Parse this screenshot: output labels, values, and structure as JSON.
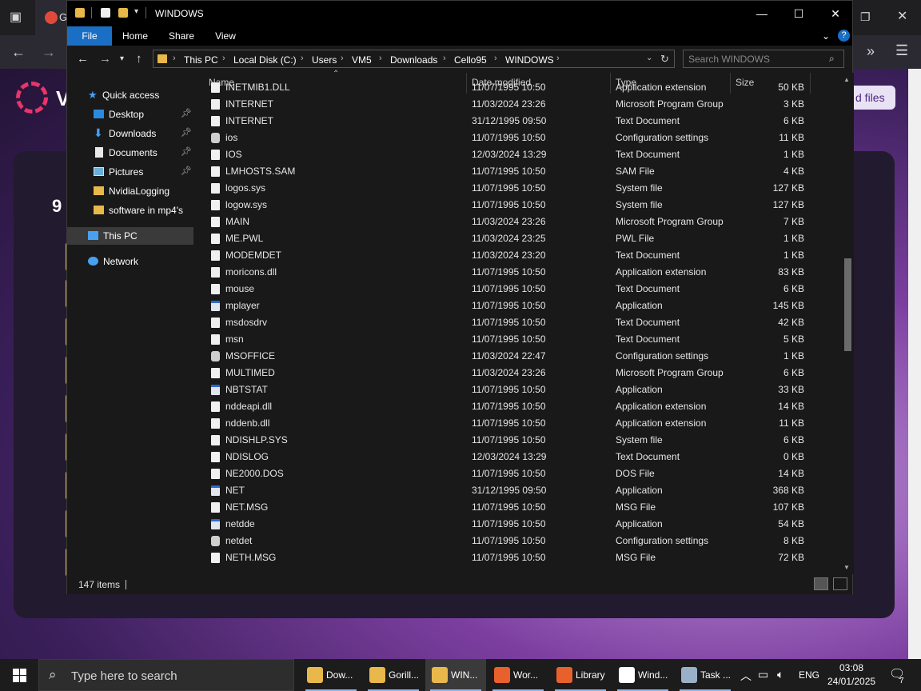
{
  "browser": {
    "tab_letter": "G",
    "site_letter": "V",
    "button_label": "d files",
    "heading_digit": "9"
  },
  "explorer": {
    "title": "WINDOWS",
    "window_controls": {
      "minimize": "—",
      "maximize": "☐",
      "close": "✕"
    },
    "ribbon_tabs": [
      "File",
      "Home",
      "Share",
      "View"
    ],
    "breadcrumbs": [
      "This PC",
      "Local Disk (C:)",
      "Users",
      "VM5",
      "Downloads",
      "Cello95",
      "WINDOWS"
    ],
    "search_placeholder": "Search WINDOWS",
    "nav_pane": {
      "quick_access": "Quick access",
      "items": [
        "Desktop",
        "Downloads",
        "Documents",
        "Pictures",
        "NvidiaLogging",
        "software in mp4's"
      ],
      "this_pc": "This PC",
      "network": "Network"
    },
    "columns": {
      "name": "Name",
      "date": "Date modified",
      "type": "Type",
      "size": "Size"
    },
    "files": [
      {
        "name": "INETMIB1.DLL",
        "date": "11/07/1995 10:50",
        "type": "Application extension",
        "size": "50 KB",
        "icon": "file-icon"
      },
      {
        "name": "INTERNET",
        "date": "11/03/2024 23:26",
        "type": "Microsoft Program Group",
        "size": "3 KB",
        "icon": "file-icon"
      },
      {
        "name": "INTERNET",
        "date": "31/12/1995 09:50",
        "type": "Text Document",
        "size": "6 KB",
        "icon": "file-icon"
      },
      {
        "name": "ios",
        "date": "11/07/1995 10:50",
        "type": "Configuration settings",
        "size": "11 KB",
        "icon": "config-icon"
      },
      {
        "name": "IOS",
        "date": "12/03/2024 13:29",
        "type": "Text Document",
        "size": "1 KB",
        "icon": "file-icon"
      },
      {
        "name": "LMHOSTS.SAM",
        "date": "11/07/1995 10:50",
        "type": "SAM File",
        "size": "4 KB",
        "icon": "file-icon"
      },
      {
        "name": "logos.sys",
        "date": "11/07/1995 10:50",
        "type": "System file",
        "size": "127 KB",
        "icon": "file-icon"
      },
      {
        "name": "logow.sys",
        "date": "11/07/1995 10:50",
        "type": "System file",
        "size": "127 KB",
        "icon": "file-icon"
      },
      {
        "name": "MAIN",
        "date": "11/03/2024 23:26",
        "type": "Microsoft Program Group",
        "size": "7 KB",
        "icon": "file-icon"
      },
      {
        "name": "ME.PWL",
        "date": "11/03/2024 23:25",
        "type": "PWL File",
        "size": "1 KB",
        "icon": "file-icon"
      },
      {
        "name": "MODEMDET",
        "date": "11/03/2024 23:20",
        "type": "Text Document",
        "size": "1 KB",
        "icon": "file-icon"
      },
      {
        "name": "moricons.dll",
        "date": "11/07/1995 10:50",
        "type": "Application extension",
        "size": "83 KB",
        "icon": "file-icon"
      },
      {
        "name": "mouse",
        "date": "11/07/1995 10:50",
        "type": "Text Document",
        "size": "6 KB",
        "icon": "file-icon"
      },
      {
        "name": "mplayer",
        "date": "11/07/1995 10:50",
        "type": "Application",
        "size": "145 KB",
        "icon": "app-icon"
      },
      {
        "name": "msdosdrv",
        "date": "11/07/1995 10:50",
        "type": "Text Document",
        "size": "42 KB",
        "icon": "file-icon"
      },
      {
        "name": "msn",
        "date": "11/07/1995 10:50",
        "type": "Text Document",
        "size": "5 KB",
        "icon": "file-icon"
      },
      {
        "name": "MSOFFICE",
        "date": "11/03/2024 22:47",
        "type": "Configuration settings",
        "size": "1 KB",
        "icon": "config-icon"
      },
      {
        "name": "MULTIMED",
        "date": "11/03/2024 23:26",
        "type": "Microsoft Program Group",
        "size": "6 KB",
        "icon": "file-icon"
      },
      {
        "name": "NBTSTAT",
        "date": "11/07/1995 10:50",
        "type": "Application",
        "size": "33 KB",
        "icon": "app-icon"
      },
      {
        "name": "nddeapi.dll",
        "date": "11/07/1995 10:50",
        "type": "Application extension",
        "size": "14 KB",
        "icon": "file-icon"
      },
      {
        "name": "nddenb.dll",
        "date": "11/07/1995 10:50",
        "type": "Application extension",
        "size": "11 KB",
        "icon": "file-icon"
      },
      {
        "name": "NDISHLP.SYS",
        "date": "11/07/1995 10:50",
        "type": "System file",
        "size": "6 KB",
        "icon": "file-icon"
      },
      {
        "name": "NDISLOG",
        "date": "12/03/2024 13:29",
        "type": "Text Document",
        "size": "0 KB",
        "icon": "file-icon"
      },
      {
        "name": "NE2000.DOS",
        "date": "11/07/1995 10:50",
        "type": "DOS File",
        "size": "14 KB",
        "icon": "file-icon"
      },
      {
        "name": "NET",
        "date": "31/12/1995 09:50",
        "type": "Application",
        "size": "368 KB",
        "icon": "app-icon"
      },
      {
        "name": "NET.MSG",
        "date": "11/07/1995 10:50",
        "type": "MSG File",
        "size": "107 KB",
        "icon": "file-icon"
      },
      {
        "name": "netdde",
        "date": "11/07/1995 10:50",
        "type": "Application",
        "size": "54 KB",
        "icon": "app-icon"
      },
      {
        "name": "netdet",
        "date": "11/07/1995 10:50",
        "type": "Configuration settings",
        "size": "8 KB",
        "icon": "config-icon"
      },
      {
        "name": "NETH.MSG",
        "date": "11/07/1995 10:50",
        "type": "MSG File",
        "size": "72 KB",
        "icon": "file-icon"
      }
    ],
    "status": "147 items"
  },
  "taskbar": {
    "search_placeholder": "Type here to search",
    "items": [
      {
        "label": "Dow...",
        "color": "#e8b84a",
        "active": false
      },
      {
        "label": "Gorill...",
        "color": "#e8b84a",
        "active": false
      },
      {
        "label": "WIN...",
        "color": "#e8b84a",
        "active": true
      },
      {
        "label": "Wor...",
        "color": "#e8612c",
        "active": false
      },
      {
        "label": "Library",
        "color": "#e8612c",
        "active": false
      },
      {
        "label": "Wind...",
        "color": "#ffffff",
        "active": false
      },
      {
        "label": "Task ...",
        "color": "#9ab0c8",
        "active": false
      }
    ],
    "language": "ENG",
    "time": "03:08",
    "date": "24/01/2025",
    "notification_count": "7"
  },
  "colors": {
    "accent": "#1a6fc4",
    "folder": "#e8b84a",
    "explorer_bg": "#191919"
  }
}
